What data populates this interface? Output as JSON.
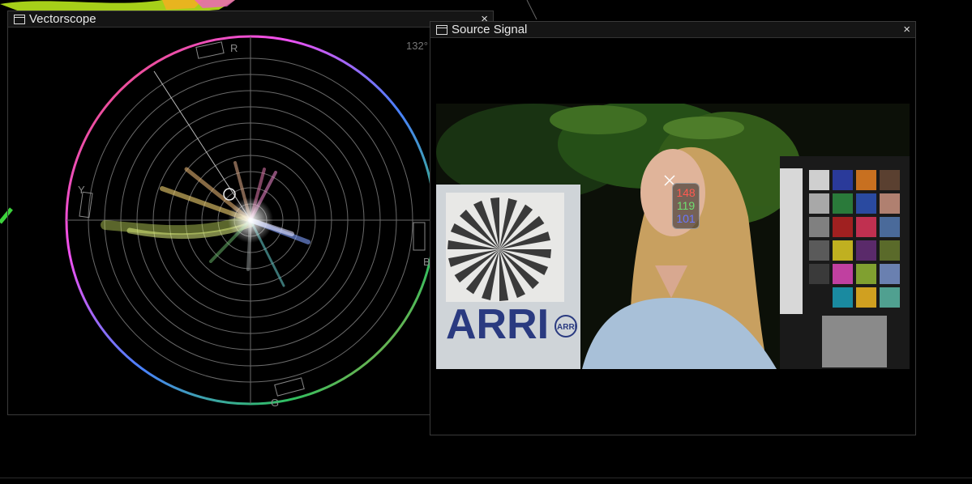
{
  "vectorscope": {
    "title": "Vectorscope",
    "close": "×",
    "angle": "132°"
  },
  "source_signal": {
    "title": "Source Signal",
    "close": "×"
  },
  "scope_labels": {
    "r": "R",
    "b": "B",
    "g": "G",
    "y": "Y"
  },
  "pixel_readout": {
    "r": "148",
    "g": "119",
    "b": "101"
  },
  "image_text": {
    "brand": "ARRI",
    "brand_small": "ARRI"
  },
  "colors": {
    "ring_start": "#e84c4c",
    "accent": "#f05030"
  }
}
